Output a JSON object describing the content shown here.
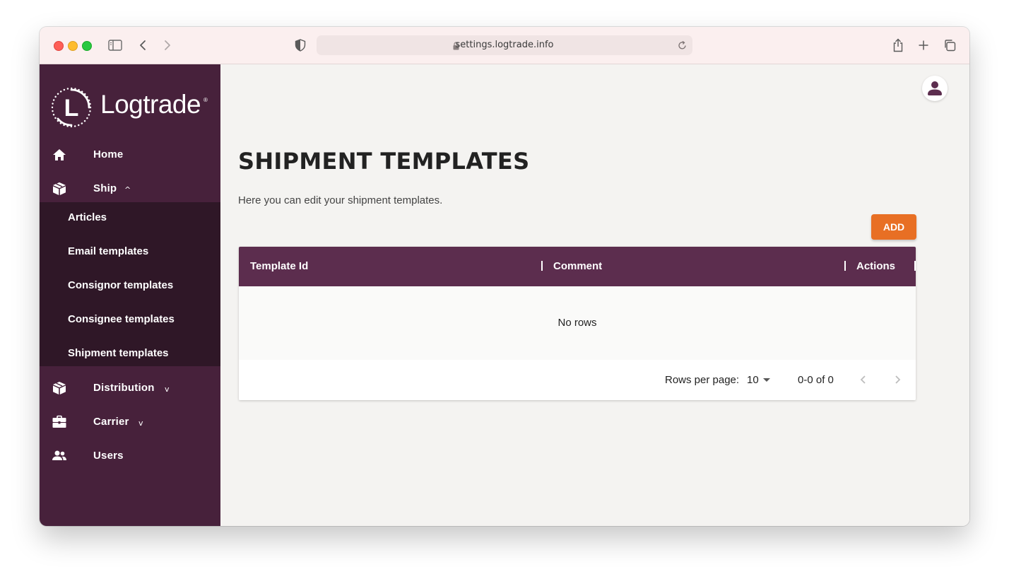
{
  "browser": {
    "url": "settings.logtrade.info"
  },
  "brand": {
    "logo_text": "Logtrade",
    "logo_letter": "L",
    "registered_mark": "®",
    "sidebar_color": "#47213b",
    "submenu_color": "#2f1727",
    "accent_color": "#e86f24",
    "header_color": "#5c2d4e"
  },
  "sidebar": {
    "items": [
      {
        "label": "Home",
        "icon": "home-icon"
      },
      {
        "label": "Ship",
        "icon": "box-icon",
        "chevron": "^"
      },
      {
        "label": "Distribution",
        "icon": "box-icon",
        "chevron": "v"
      },
      {
        "label": "Carrier",
        "icon": "briefcase-icon",
        "chevron": "v"
      },
      {
        "label": "Users",
        "icon": "users-icon"
      }
    ],
    "ship_submenu": [
      {
        "label": "Articles"
      },
      {
        "label": "Email templates"
      },
      {
        "label": "Consignor templates"
      },
      {
        "label": "Consignee templates"
      },
      {
        "label": "Shipment templates"
      }
    ]
  },
  "page": {
    "title": "SHIPMENT TEMPLATES",
    "description": "Here you can edit your shipment templates.",
    "add_label": "ADD"
  },
  "grid": {
    "columns": [
      "Template Id",
      "Comment",
      "Actions"
    ],
    "empty_text": "No rows",
    "rows_per_page_label": "Rows per page:",
    "rows_per_page_value": "10",
    "range_text": "0-0 of 0"
  }
}
